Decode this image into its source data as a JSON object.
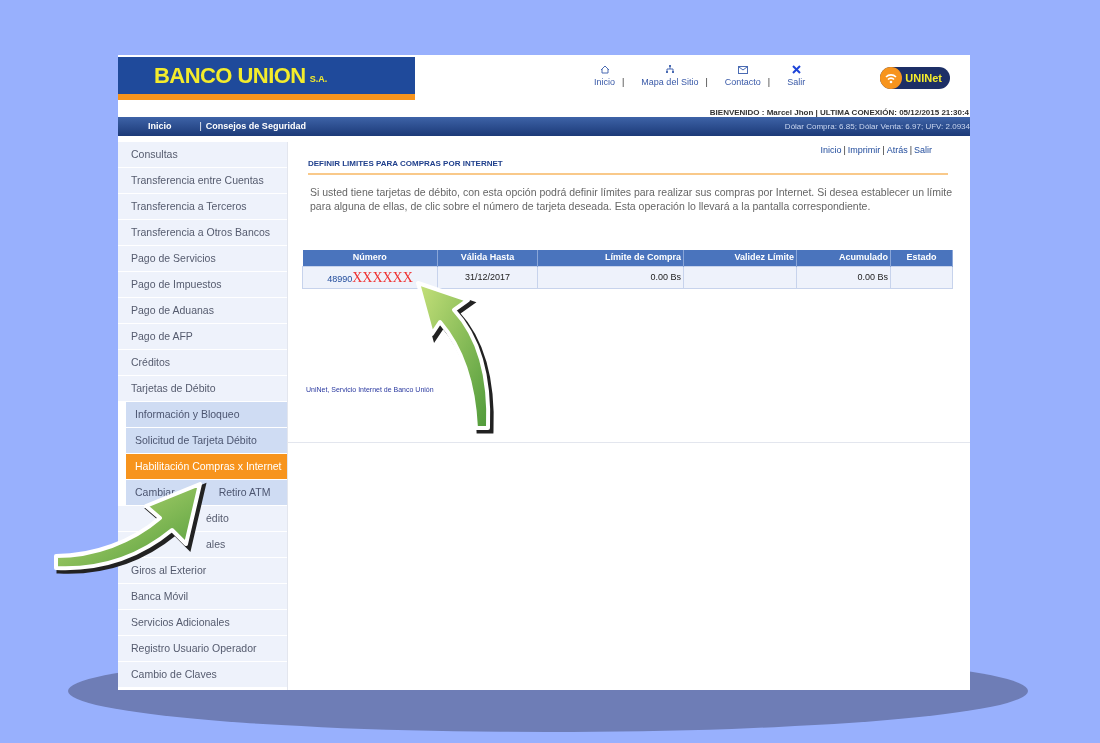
{
  "header": {
    "logo": "BANCO UNION",
    "logo_suffix": "S.A.",
    "nav": [
      {
        "label": "Inicio",
        "separator": "|"
      },
      {
        "label": "Mapa del Sitio",
        "separator": "|"
      },
      {
        "label": "Contacto",
        "separator": "|"
      },
      {
        "label": "Salir"
      }
    ],
    "brand": "UNINet",
    "welcome": "BIENVENIDO : Marcel Jhon | ULTIMA CONEXIÓN: 05/12/2015 21:30:4"
  },
  "menu_bar": {
    "items": [
      "Inicio",
      "Consejos de Seguridad"
    ],
    "separator": "|",
    "rates": "Dólar Compra: 6.85; Dólar Venta: 6.97; UFV: 2.0934"
  },
  "sidebar": {
    "items": [
      {
        "label": "Consultas",
        "kind": "main",
        "selected": false
      },
      {
        "label": "Transferencia entre Cuentas",
        "kind": "main",
        "selected": false
      },
      {
        "label": "Transferencia a Terceros",
        "kind": "main",
        "selected": false
      },
      {
        "label": "Transferencia a Otros Bancos",
        "kind": "main",
        "selected": false
      },
      {
        "label": "Pago de Servicios",
        "kind": "main",
        "selected": false
      },
      {
        "label": "Pago de Impuestos",
        "kind": "main",
        "selected": false
      },
      {
        "label": "Pago de Aduanas",
        "kind": "main",
        "selected": false
      },
      {
        "label": "Pago de AFP",
        "kind": "main",
        "selected": false
      },
      {
        "label": "Créditos",
        "kind": "main",
        "selected": false
      },
      {
        "label": "Tarjetas de Débito",
        "kind": "main",
        "selected": false
      },
      {
        "label": "Información y Bloqueo",
        "kind": "sub",
        "selected": false
      },
      {
        "label": "Solicitud de Tarjeta Débito",
        "kind": "sub",
        "selected": false
      },
      {
        "label": "Habilitación Compras x Internet",
        "kind": "sub",
        "selected": true
      },
      {
        "parts": [
          "Cambiar",
          "Retiro ATM"
        ],
        "kind": "sub_split",
        "selected": false
      },
      {
        "label": "édito",
        "kind": "main_covered",
        "selected": false
      },
      {
        "label": "ales",
        "kind": "main_covered",
        "selected": false
      },
      {
        "label": "Giros al Exterior",
        "kind": "main",
        "selected": false
      },
      {
        "label": "Banca Móvil",
        "kind": "main",
        "selected": false
      },
      {
        "label": "Servicios Adicionales",
        "kind": "main",
        "selected": false
      },
      {
        "label": "Registro Usuario Operador",
        "kind": "main",
        "selected": false
      },
      {
        "label": "Cambio de Claves",
        "kind": "main",
        "selected": false
      }
    ]
  },
  "content": {
    "links": [
      "Inicio",
      "Imprimir",
      "Atrás",
      "Salir"
    ],
    "link_separator": "|",
    "title": "DEFINIR LIMITES PARA COMPRAS POR INTERNET",
    "description": "Si usted tiene tarjetas  de débito, con esta opción podrá definir límites para realizar sus compras por Internet. Si desea establecer un límite para alguna de ellas, de clic sobre el número de tarjeta deseada. Esta operación lo llevará a la pantalla correspondiente.",
    "table": {
      "columns": [
        "Número",
        "Válida Hasta",
        "Límite de Compra",
        "Validez Límite",
        "Acumulado",
        "Estado"
      ],
      "rows": [
        {
          "number": "48990",
          "masked": "XXXXXX",
          "valid_until": "31/12/2017",
          "limit": "0.00 Bs",
          "accumulated": "0.00 Bs"
        }
      ]
    },
    "footer": "UniNet, Servicio Internet de Banco Unión"
  }
}
